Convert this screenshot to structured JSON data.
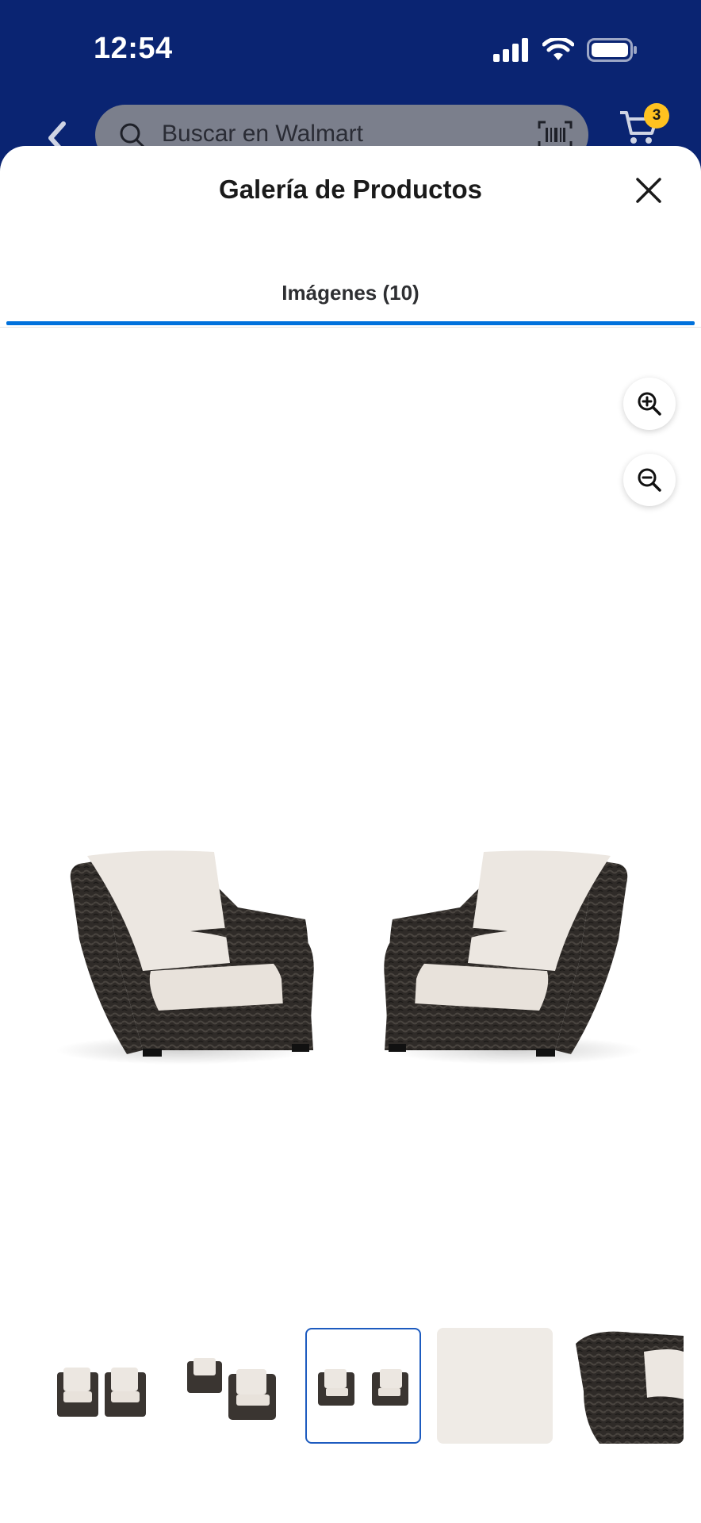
{
  "status_bar": {
    "time": "12:54"
  },
  "header": {
    "search_placeholder": "Buscar en Walmart",
    "cart_count": "3"
  },
  "sheet": {
    "title": "Galería de Productos",
    "tabs": [
      {
        "label": "Imágenes (10)",
        "selected": true
      }
    ]
  },
  "gallery": {
    "selected_thumbnail": 3,
    "thumbnails": [
      {
        "name": "two-chairs-front"
      },
      {
        "name": "two-chairs-angled"
      },
      {
        "name": "two-chairs-apart"
      },
      {
        "name": "cushion-fabric-swatch"
      },
      {
        "name": "wicker-arm-detail"
      }
    ]
  },
  "colors": {
    "header_blue": "#0a2472",
    "accent_blue": "#0071dc",
    "badge_yellow": "#ffc220"
  }
}
